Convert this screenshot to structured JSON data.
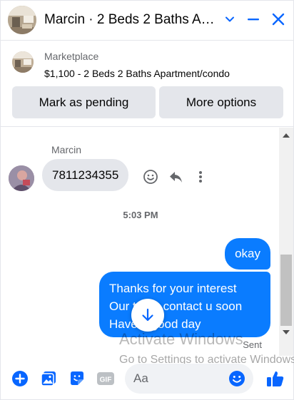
{
  "header": {
    "title": "Marcin · 2 Beds 2 Baths Ap...",
    "avatar_icon": "listing-photo-icon",
    "chevron_icon": "chevron-down-icon",
    "minimize_icon": "minimize-icon",
    "close_icon": "close-icon"
  },
  "listing": {
    "source": "Marketplace",
    "title": "$1,100 - 2 Beds 2 Baths Apartment/condo",
    "mark_pending_label": "Mark as pending",
    "more_options_label": "More options"
  },
  "messages": {
    "sender_name": "Marcin",
    "received": "7811234355",
    "time": "5:03 PM",
    "sent_short": "okay",
    "sent_long_lines": [
      "Thanks for your interest",
      "Our team contact u soon",
      "Have a good day"
    ],
    "status": "Sent"
  },
  "watermark": {
    "title": "Activate Windows",
    "subtitle": "Go to Settings to activate Windows."
  },
  "composer": {
    "placeholder": "Aa",
    "gif_label": "GIF"
  },
  "colors": {
    "accent": "#0a7cff",
    "icon_blue": "#0866ff",
    "bubble_gray": "#e4e6eb",
    "meta_gray": "#65676b"
  }
}
